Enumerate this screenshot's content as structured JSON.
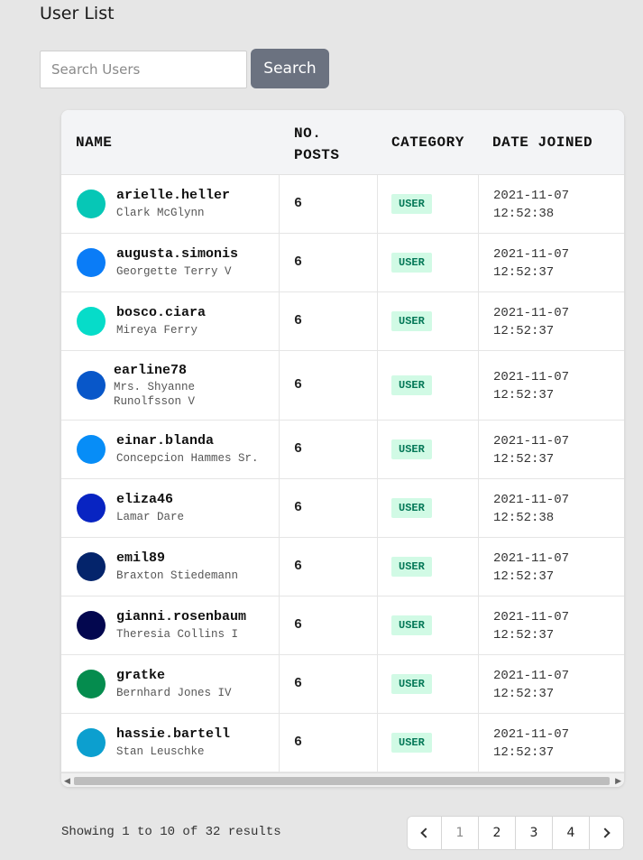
{
  "page": {
    "title": "User List"
  },
  "search": {
    "placeholder": "Search Users",
    "button_label": "Search"
  },
  "table": {
    "columns": {
      "name": "NAME",
      "posts_line1": "NO.",
      "posts_line2": "POSTS",
      "category": "CATEGORY",
      "date": "DATE JOINED"
    },
    "rows": [
      {
        "username": "arielle.heller",
        "full_name": "Clark McGlynn",
        "posts": "6",
        "category": "USER",
        "date": "2021-11-07",
        "time": "12:52:38",
        "avatar_color": "#06c7b6"
      },
      {
        "username": "augusta.simonis",
        "full_name": "Georgette Terry V",
        "posts": "6",
        "category": "USER",
        "date": "2021-11-07",
        "time": "12:52:37",
        "avatar_color": "#0a7cf7"
      },
      {
        "username": "bosco.ciara",
        "full_name": "Mireya Ferry",
        "posts": "6",
        "category": "USER",
        "date": "2021-11-07",
        "time": "12:52:37",
        "avatar_color": "#06dcc9"
      },
      {
        "username": "earline78",
        "full_name": "Mrs. Shyanne Runolfsson V",
        "posts": "6",
        "category": "USER",
        "date": "2021-11-07",
        "time": "12:52:37",
        "avatar_color": "#0857c9"
      },
      {
        "username": "einar.blanda",
        "full_name": "Concepcion Hammes Sr.",
        "posts": "6",
        "category": "USER",
        "date": "2021-11-07",
        "time": "12:52:37",
        "avatar_color": "#078df7"
      },
      {
        "username": "eliza46",
        "full_name": "Lamar Dare",
        "posts": "6",
        "category": "USER",
        "date": "2021-11-07",
        "time": "12:52:38",
        "avatar_color": "#0824c2"
      },
      {
        "username": "emil89",
        "full_name": "Braxton Stiedemann",
        "posts": "6",
        "category": "USER",
        "date": "2021-11-07",
        "time": "12:52:37",
        "avatar_color": "#04246b"
      },
      {
        "username": "gianni.rosenbaum",
        "full_name": "Theresia Collins I",
        "posts": "6",
        "category": "USER",
        "date": "2021-11-07",
        "time": "12:52:37",
        "avatar_color": "#03074f"
      },
      {
        "username": "gratke",
        "full_name": "Bernhard Jones IV",
        "posts": "6",
        "category": "USER",
        "date": "2021-11-07",
        "time": "12:52:37",
        "avatar_color": "#058c4e"
      },
      {
        "username": "hassie.bartell",
        "full_name": "Stan Leuschke",
        "posts": "6",
        "category": "USER",
        "date": "2021-11-07",
        "time": "12:52:37",
        "avatar_color": "#0c9fcf"
      }
    ]
  },
  "footer": {
    "results_text": "Showing 1 to 10 of 32 results",
    "pages": [
      "1",
      "2",
      "3",
      "4"
    ],
    "current_page": "1",
    "prev_icon": "chevron-left-icon",
    "next_icon": "chevron-right-icon"
  },
  "colors": {
    "search_button": "#6b7280",
    "badge_bg": "#d1fae5",
    "badge_text": "#047857",
    "page_bg": "#e6e6e6"
  }
}
